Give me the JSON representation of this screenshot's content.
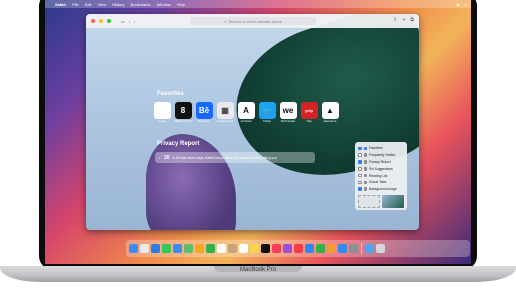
{
  "menubar": {
    "apple": "",
    "app": "Safari",
    "items": [
      "File",
      "Edit",
      "View",
      "History",
      "Bookmarks",
      "Window",
      "Help"
    ]
  },
  "toolbar": {
    "url_placeholder": "Search or enter website name"
  },
  "favorites": {
    "title": "Favorites",
    "items": [
      {
        "label": "Apple",
        "glyph": "",
        "bg": "#ffffff",
        "fg": "#222"
      },
      {
        "label": "80000 OOOO",
        "glyph": "8",
        "bg": "#111111",
        "fg": "#fff"
      },
      {
        "label": "Behance",
        "glyph": "Bē",
        "bg": "#1769ff",
        "fg": "#fff"
      },
      {
        "label": "Google Maps",
        "glyph": "▦",
        "bg": "#e9e9ee",
        "fg": "#444"
      },
      {
        "label": "Architect",
        "glyph": "A",
        "bg": "#ffffff",
        "fg": "#111"
      },
      {
        "label": "Twitter",
        "glyph": "🐦",
        "bg": "#1da1f2",
        "fg": "#fff"
      },
      {
        "label": "WeTransfer",
        "glyph": "we",
        "bg": "#ffffff",
        "fg": "#111"
      },
      {
        "label": "Yelp",
        "glyph": "yelp",
        "bg": "#d32323",
        "fg": "#fff"
      },
      {
        "label": "Adventure",
        "glyph": "▲",
        "bg": "#ffffff",
        "fg": "#111"
      }
    ]
  },
  "privacy": {
    "title": "Privacy Report",
    "count": "20",
    "text": "In the last seven days, Safari has prevented 20 trackers from profiling you."
  },
  "customize": {
    "options": [
      {
        "label": "Favorites",
        "checked": true,
        "color": "#3b7bf6"
      },
      {
        "label": "Frequently Visited",
        "checked": false,
        "color": "#8a8a8e"
      },
      {
        "label": "Privacy Report",
        "checked": true,
        "color": "#8a8a8e"
      },
      {
        "label": "Siri Suggestions",
        "checked": false,
        "color": "#8a8a8e"
      },
      {
        "label": "Reading List",
        "checked": false,
        "color": "#8a8a8e"
      },
      {
        "label": "iCloud Tabs",
        "checked": false,
        "color": "#8a8a8e"
      },
      {
        "label": "Background Image",
        "checked": true,
        "color": "#8a8a8e"
      }
    ]
  },
  "dock": {
    "apps": [
      {
        "name": "Finder",
        "bg": "#3a8ef6"
      },
      {
        "name": "Launchpad",
        "bg": "#e8e8ee"
      },
      {
        "name": "Safari",
        "bg": "#2b7de9"
      },
      {
        "name": "Messages",
        "bg": "#34c759"
      },
      {
        "name": "Mail",
        "bg": "#3d8df5"
      },
      {
        "name": "Maps",
        "bg": "#5bbf6a"
      },
      {
        "name": "Photos",
        "bg": "#f5a623"
      },
      {
        "name": "FaceTime",
        "bg": "#2fb34e"
      },
      {
        "name": "Calendar",
        "bg": "#ffffff"
      },
      {
        "name": "Contacts",
        "bg": "#c9a27b"
      },
      {
        "name": "Reminders",
        "bg": "#ffffff"
      },
      {
        "name": "Notes",
        "bg": "#f7d54a"
      },
      {
        "name": "Apple TV",
        "bg": "#111111"
      },
      {
        "name": "Music",
        "bg": "#fa3c5a"
      },
      {
        "name": "Podcasts",
        "bg": "#9b4fd6"
      },
      {
        "name": "News",
        "bg": "#f23d4a"
      },
      {
        "name": "Keynote",
        "bg": "#2f87f0"
      },
      {
        "name": "Numbers",
        "bg": "#33b24a"
      },
      {
        "name": "Pages",
        "bg": "#f59b2b"
      },
      {
        "name": "App Store",
        "bg": "#2d8cf0"
      },
      {
        "name": "System Preferences",
        "bg": "#8e8e93"
      },
      {
        "name": "Downloads",
        "bg": "#4aa3f5"
      },
      {
        "name": "Trash",
        "bg": "#d4d6da"
      }
    ]
  },
  "laptop": {
    "brand": "MacBook Pro"
  }
}
